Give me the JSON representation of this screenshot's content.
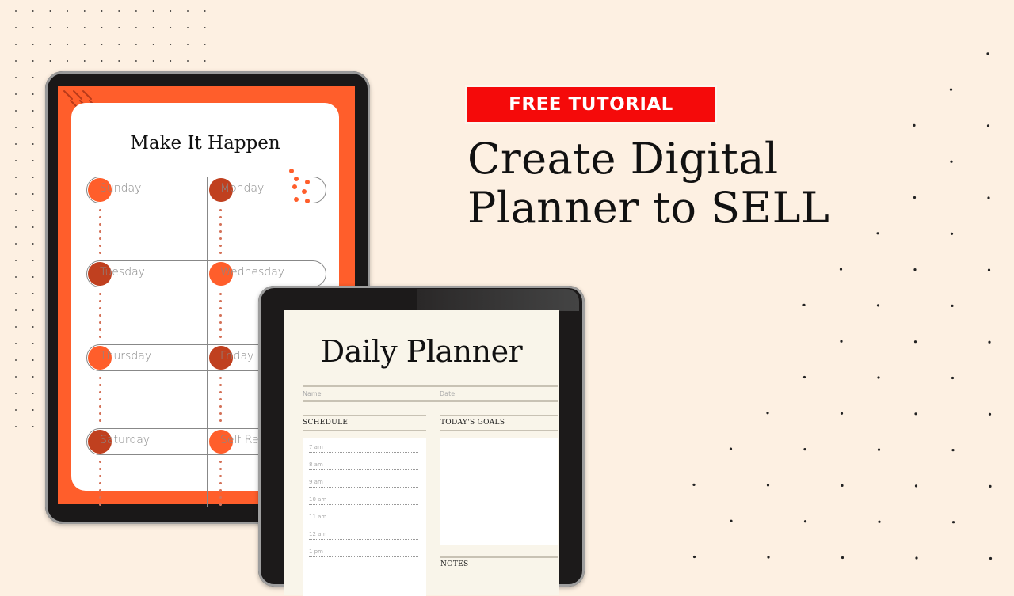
{
  "badge": {
    "label": "FREE TUTORIAL",
    "color": "#f50a0a"
  },
  "headline": {
    "line1": "Create Digital",
    "line2": "Planner to SELL"
  },
  "planner_weekly": {
    "title": "Make It Happen",
    "accent": "#ff5e2b",
    "days": [
      "Sunday",
      "Monday",
      "Tuesday",
      "Wednesday",
      "Thursday",
      "Friday",
      "Saturday",
      "Self Re"
    ]
  },
  "planner_daily": {
    "title": "Daily Planner",
    "name_label": "Name",
    "date_label": "Date",
    "schedule_label": "SCHEDULE",
    "goals_label": "TODAY'S GOALS",
    "notes_label": "NOTES",
    "times": [
      "7 am",
      "8 am",
      "9 am",
      "10 am",
      "11 am",
      "12 am",
      "1 pm"
    ]
  },
  "colors": {
    "background": "#fdf0e2",
    "dot": "#222222",
    "circle_light": "#ff5e2b",
    "circle_dark": "#c0401f"
  }
}
